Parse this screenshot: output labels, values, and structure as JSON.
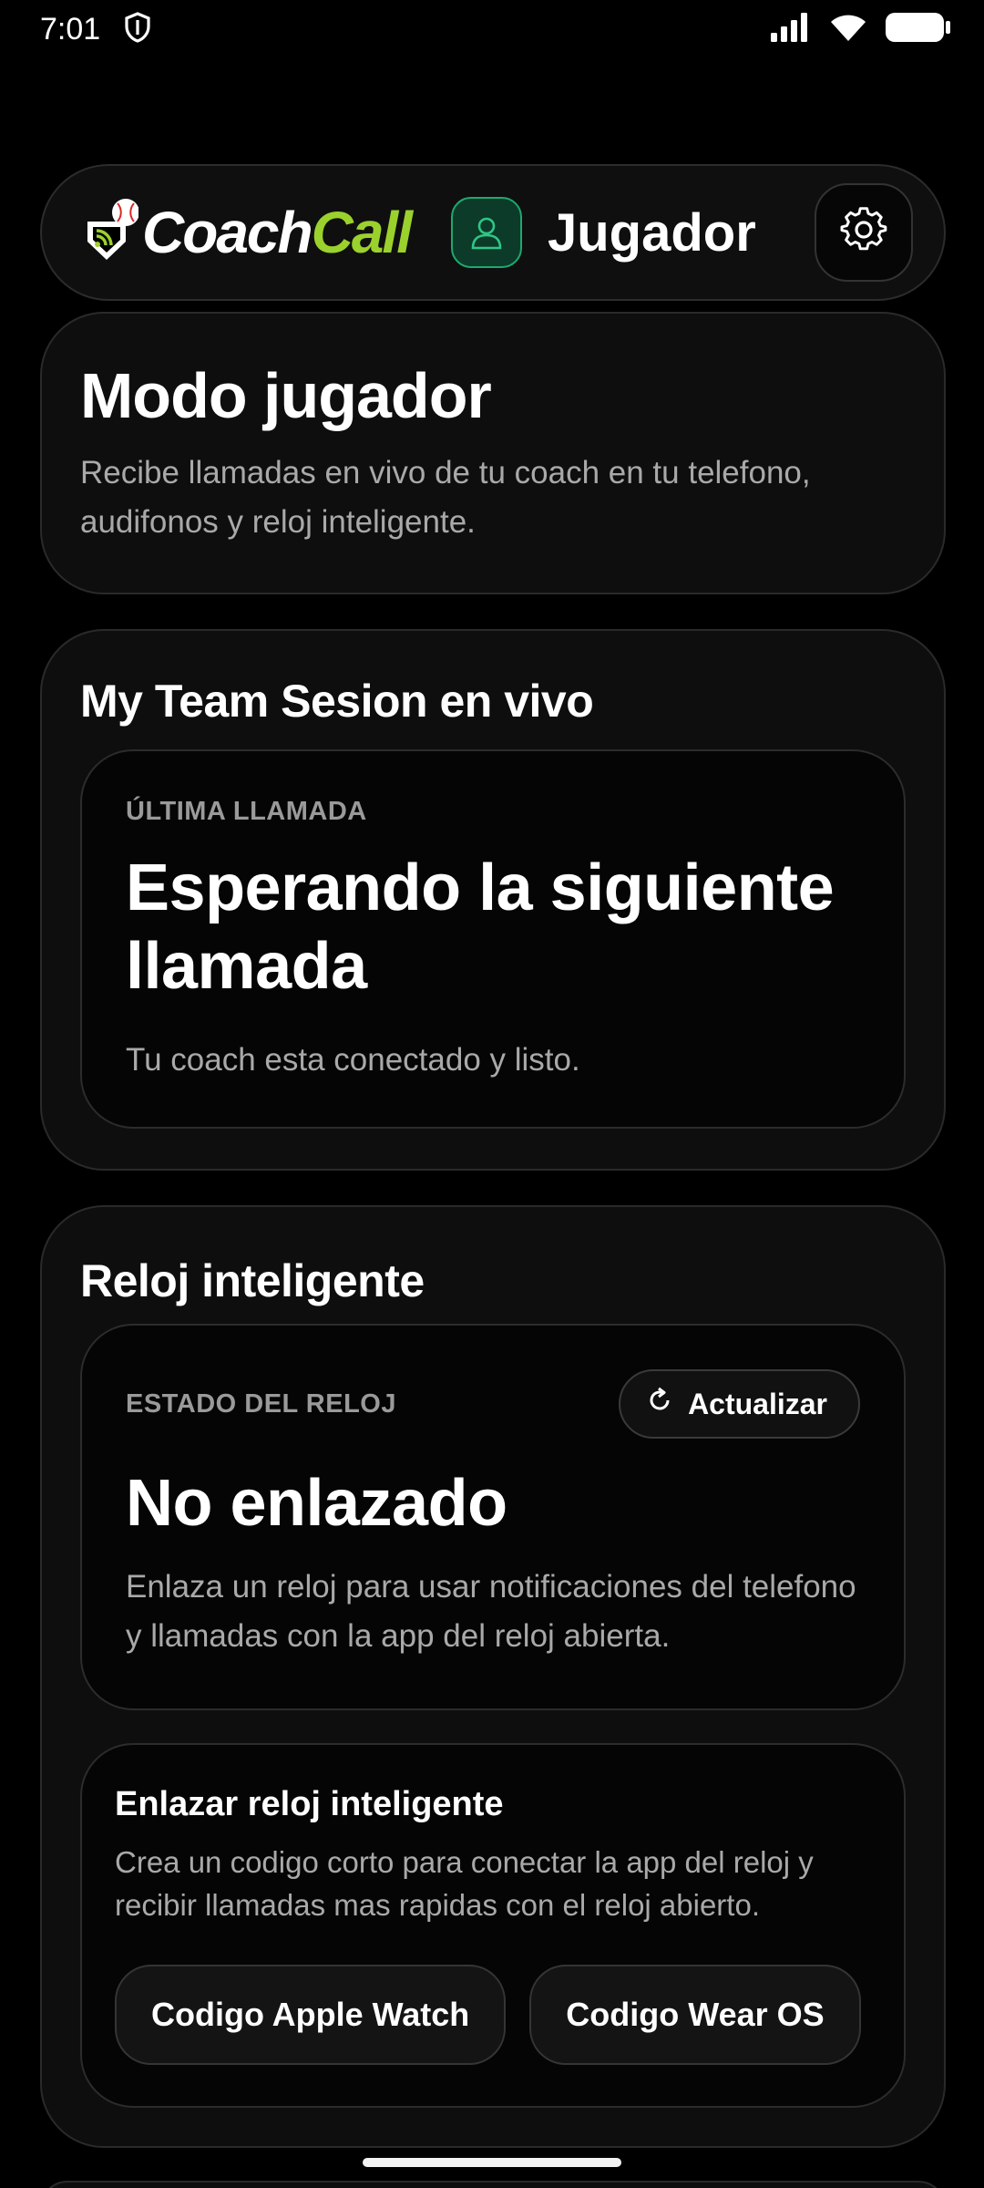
{
  "status_bar": {
    "time": "7:01",
    "icons": [
      "shield-icon",
      "signal-icon",
      "wifi-icon",
      "battery-icon"
    ]
  },
  "header": {
    "logo_coach": "Coach",
    "logo_call": "Call",
    "role_label": "Jugador",
    "icons": [
      "person-icon",
      "gear-icon"
    ]
  },
  "mode_card": {
    "title": "Modo jugador",
    "description": "Recibe llamadas en vivo de tu coach en tu telefono, audifonos y reloj inteligente."
  },
  "session_card": {
    "title": "My Team Sesion en vivo",
    "eyebrow": "ÚLTIMA LLAMADA",
    "status": "Esperando la siguiente llamada",
    "description": "Tu coach esta conectado y listo."
  },
  "watch_card": {
    "title": "Reloj inteligente",
    "eyebrow": "ESTADO DEL RELOJ",
    "refresh_label": "Actualizar",
    "status": "No enlazado",
    "description": "Enlaza un reloj para usar notificaciones del telefono y llamadas con la app del reloj abierta.",
    "link": {
      "title": "Enlazar reloj inteligente",
      "description": "Crea un codigo corto para conectar la app del reloj y recibir llamadas mas rapidas con el reloj abierto.",
      "apple_label": "Codigo Apple Watch",
      "wear_label": "Codigo Wear OS"
    }
  },
  "colors": {
    "background": "#000000",
    "card": "#0e0e0e",
    "accent_green": "#9bd12c",
    "role_green": "#1fa86f",
    "muted_text": "#a9a9a9"
  }
}
